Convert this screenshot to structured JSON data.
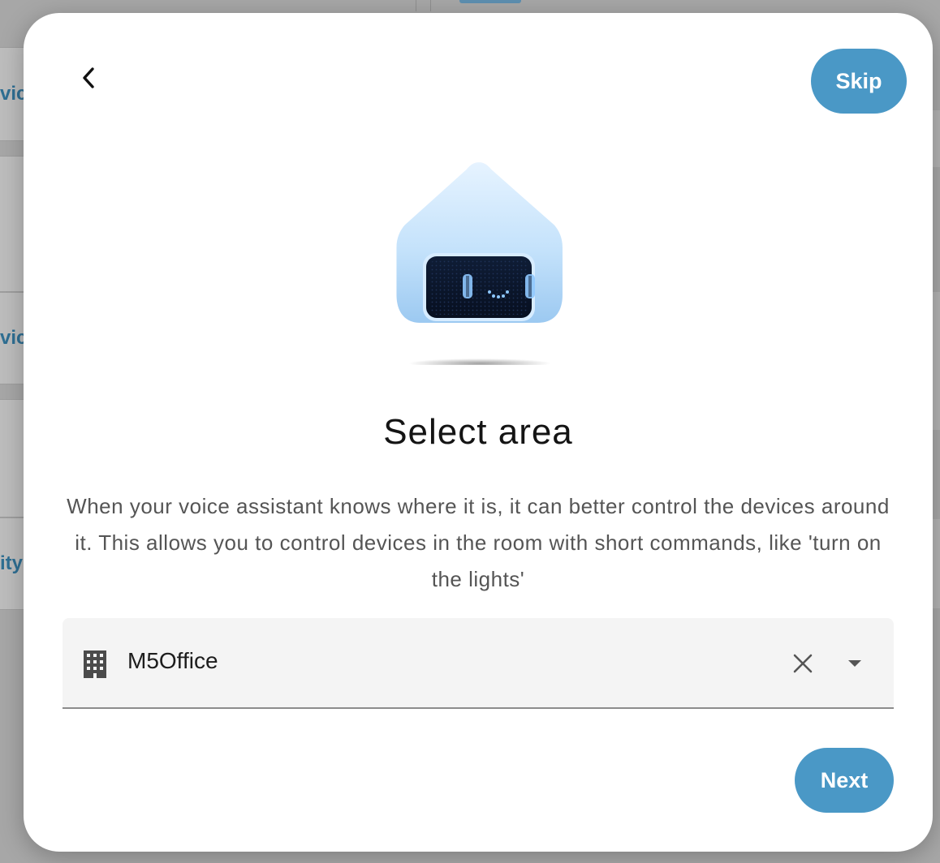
{
  "background": {
    "fragments": [
      "vic",
      "vic",
      "ity"
    ]
  },
  "dialog": {
    "skip_label": "Skip",
    "title": "Select area",
    "description": "When your voice assistant knows where it is, it can better control the devices around it. This allows you to control devices in the room with short commands, like 'turn on the lights'",
    "area_field": {
      "value": "M5Office",
      "icon": "building-icon"
    },
    "next_label": "Next"
  },
  "colors": {
    "accent": "#4a98c6",
    "overlay": "#a7a7a7",
    "field_bg": "#f4f4f4"
  }
}
